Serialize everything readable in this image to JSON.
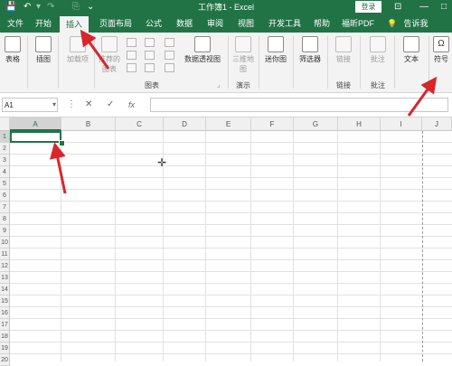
{
  "app": {
    "title": "工作簿1 - Excel",
    "login_label": "登录",
    "qat": {
      "save_icon": "save-icon",
      "undo_icon": "undo-icon",
      "redo_icon": "redo-icon",
      "customize_icon": "customize-icon"
    }
  },
  "tabs": [
    "文件",
    "开始",
    "插入",
    "页面布局",
    "公式",
    "数据",
    "审阅",
    "视图",
    "开发工具",
    "帮助",
    "福昕PDF",
    "告诉我"
  ],
  "active_tab": "插入",
  "ribbon": {
    "table": "表格",
    "illustrations": "插图",
    "addins": "加载项",
    "recommended_charts": "推荐的图表",
    "pivot_chart": "数据透视图",
    "map_3d": "三维地图",
    "sparklines": "迷你图",
    "filters": "筛选器",
    "link": "链接",
    "comment": "批注",
    "text": "文本",
    "symbols": "符号",
    "groups": {
      "charts": "图表",
      "tours": "演示",
      "links": "链接",
      "comments": "批注"
    }
  },
  "formula_bar": {
    "name_box": "A1",
    "cancel": "✕",
    "enter": "✓",
    "fx": "fx",
    "value": ""
  },
  "columns": [
    "A",
    "B",
    "C",
    "D",
    "E",
    "F",
    "G",
    "H",
    "I",
    "J"
  ],
  "rows": [
    "1",
    "2",
    "3",
    "4",
    "5",
    "6",
    "7",
    "8",
    "9",
    "10",
    "11",
    "12",
    "13",
    "14",
    "15",
    "16",
    "17",
    "18",
    "19",
    "20"
  ],
  "selected_cell": "A1",
  "colors": {
    "brand": "#217346",
    "annotation_arrow": "#d9262c"
  }
}
